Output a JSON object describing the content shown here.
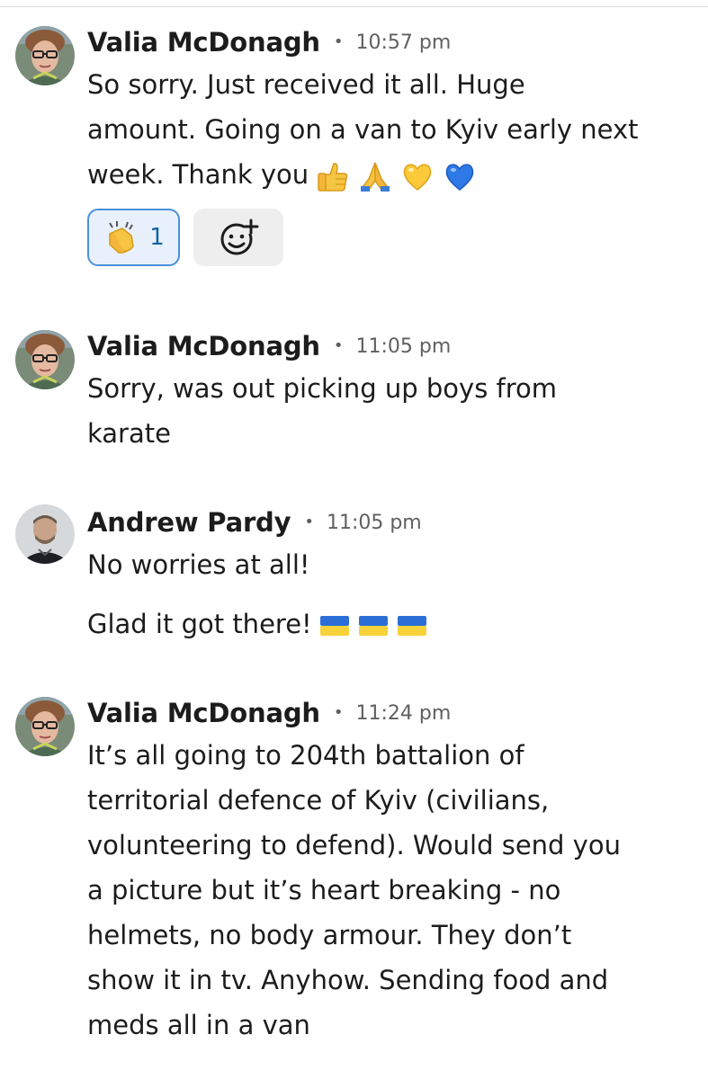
{
  "messages": [
    {
      "author": "Valia McDonagh",
      "separator": "•",
      "time": "10:57 pm",
      "lines": [
        "So sorry. Just received it all. Huge",
        "amount. Going on a van to Kyiv early next",
        "week. Thank you"
      ],
      "trailing_emoji": [
        "thumbs-up",
        "folded-hands",
        "yellow-heart",
        "blue-heart"
      ],
      "reactions": [
        {
          "emoji": "clapping-hands",
          "count": "1"
        }
      ],
      "add_reaction_icon": "add-reaction-icon"
    },
    {
      "author": "Valia McDonagh",
      "separator": "•",
      "time": "11:05 pm",
      "lines": [
        "Sorry, was out picking up boys from",
        "karate"
      ]
    },
    {
      "author": "Andrew Pardy",
      "separator": "•",
      "time": "11:05 pm",
      "lines": [
        "No worries at all!",
        "Glad it got there!"
      ],
      "trailing_emoji": [
        "ukraine-flag",
        "ukraine-flag",
        "ukraine-flag"
      ]
    },
    {
      "author": "Valia McDonagh",
      "separator": "•",
      "time": "11:24 pm",
      "lines": [
        "It’s all going to 204th battalion of",
        "territorial defence of Kyiv (civilians,",
        "volunteering to defend). Would send you",
        "a picture but it’s heart breaking - no",
        "helmets, no body armour. They don’t",
        "show it in tv. Anyhow. Sending food and",
        "meds all in a van"
      ]
    }
  ],
  "colors": {
    "text": "#1d1c1d",
    "muted": "#616061",
    "reaction_border": "#4a90d9",
    "reaction_bg": "#e8f1fb",
    "reaction_count": "#1264a3"
  }
}
